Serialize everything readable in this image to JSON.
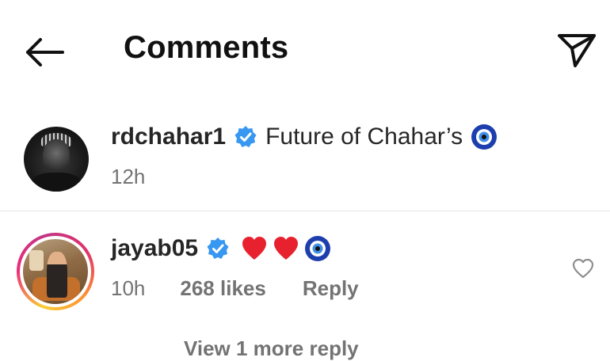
{
  "header": {
    "title": "Comments",
    "back_icon": "arrow-left-icon",
    "share_icon": "paper-plane-icon"
  },
  "caption": {
    "username": "rdchahar1",
    "verified_icon": "verified-badge-icon",
    "text": "Future of Chahar’s",
    "emoji_icon": "nazar-amulet-icon",
    "time": "12h"
  },
  "comments": [
    {
      "username": "jayab05",
      "verified_icon": "verified-badge-icon",
      "emoji_icons": [
        "red-heart-icon",
        "red-heart-icon",
        "nazar-amulet-icon"
      ],
      "time": "10h",
      "likes": "268 likes",
      "reply_label": "Reply",
      "like_icon": "heart-outline-icon",
      "view_replies": "View 1 more reply"
    }
  ],
  "colors": {
    "text_primary": "#262626",
    "text_secondary": "#737373",
    "verified_blue": "#3897f0",
    "divider": "#e6e6e6"
  }
}
